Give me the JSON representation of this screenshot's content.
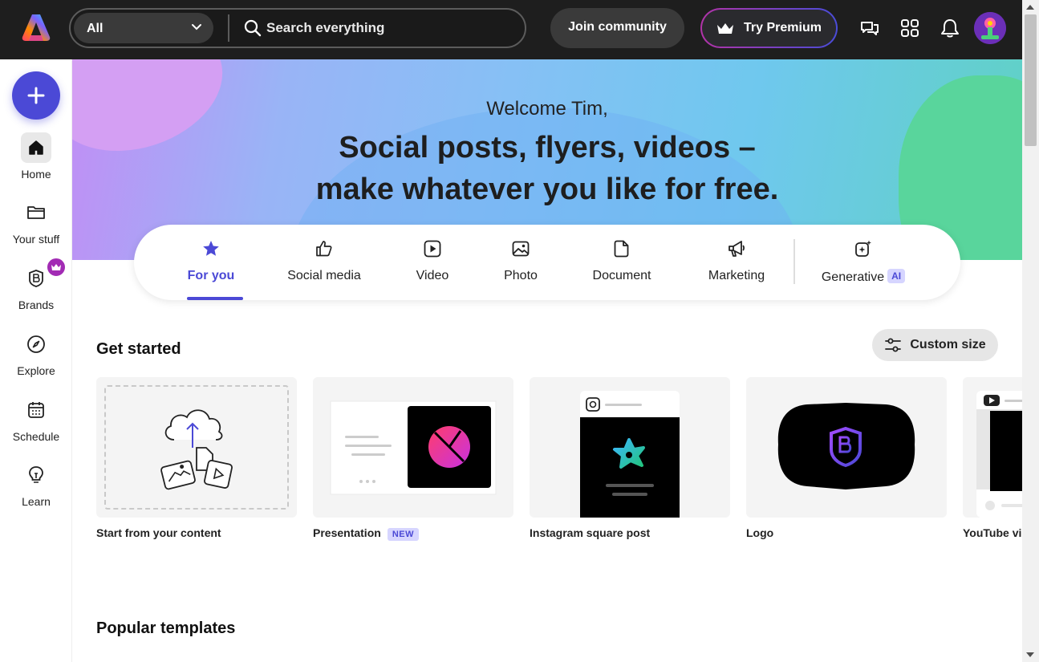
{
  "topbar": {
    "scope_label": "All",
    "search_placeholder": "Search everything",
    "join_label": "Join community",
    "premium_label": "Try Premium"
  },
  "sidebar": {
    "items": [
      {
        "label": "Home",
        "icon": "home-icon"
      },
      {
        "label": "Your stuff",
        "icon": "folder-icon"
      },
      {
        "label": "Brands",
        "icon": "brand-icon"
      },
      {
        "label": "Explore",
        "icon": "compass-icon"
      },
      {
        "label": "Schedule",
        "icon": "calendar-icon"
      },
      {
        "label": "Learn",
        "icon": "lightbulb-icon"
      }
    ]
  },
  "hero": {
    "welcome": "Welcome Tim,",
    "title_line1": "Social posts, flyers, videos –",
    "title_line2": "make whatever you like for free."
  },
  "tabs": [
    {
      "label": "For you",
      "icon": "star-icon"
    },
    {
      "label": "Social media",
      "icon": "thumbs-up-icon"
    },
    {
      "label": "Video",
      "icon": "play-icon"
    },
    {
      "label": "Photo",
      "icon": "image-icon"
    },
    {
      "label": "Document",
      "icon": "document-icon"
    },
    {
      "label": "Marketing",
      "icon": "megaphone-icon"
    },
    {
      "label": "Generative",
      "icon": "sparkle-icon",
      "badge": "AI"
    }
  ],
  "get_started": {
    "title": "Get started",
    "custom_size_label": "Custom size",
    "cards": [
      {
        "label": "Start from your content"
      },
      {
        "label": "Presentation",
        "badge": "NEW"
      },
      {
        "label": "Instagram square post"
      },
      {
        "label": "Logo"
      },
      {
        "label": "YouTube vid"
      }
    ]
  },
  "popular": {
    "title": "Popular templates"
  },
  "colors": {
    "accent": "#4b49d6",
    "topbar_bg": "#1e1e1e",
    "premium_border_start": "#b233a8",
    "premium_border_end": "#4a4cd8"
  }
}
